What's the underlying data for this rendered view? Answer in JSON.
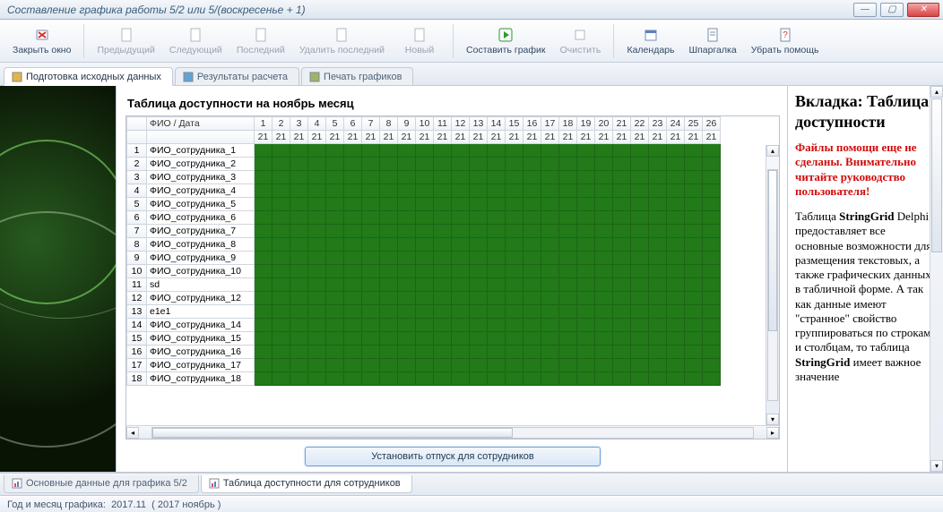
{
  "window": {
    "title": "Составление графика работы 5/2 или 5/(воскресенье + 1)"
  },
  "toolbar": {
    "close": "Закрыть окно",
    "prev": "Предыдущий",
    "next": "Следующий",
    "last": "Последний",
    "delete_last": "Удалить последний",
    "new": "Новый",
    "make": "Составить график",
    "clear": "Очистить",
    "calendar": "Календарь",
    "cheat": "Шпаргалка",
    "hide_help": "Убрать помощь"
  },
  "tabs_top": [
    {
      "label": "Подготовка исходных данных",
      "active": true
    },
    {
      "label": "Результаты расчета",
      "active": false
    },
    {
      "label": "Печать графиков",
      "active": false
    }
  ],
  "heading": "Таблица доступности на ноябрь месяц",
  "grid": {
    "fio_header": "ФИО / Дата",
    "days": [
      1,
      2,
      3,
      4,
      5,
      6,
      7,
      8,
      9,
      10,
      11,
      12,
      13,
      14,
      15,
      16,
      17,
      18,
      19,
      20,
      21,
      22,
      23,
      24,
      25,
      26
    ],
    "row2_value": "21",
    "rows": [
      {
        "n": 1,
        "fio": "ФИО_сотрудника_1"
      },
      {
        "n": 2,
        "fio": "ФИО_сотрудника_2"
      },
      {
        "n": 3,
        "fio": "ФИО_сотрудника_3"
      },
      {
        "n": 4,
        "fio": "ФИО_сотрудника_4"
      },
      {
        "n": 5,
        "fio": "ФИО_сотрудника_5"
      },
      {
        "n": 6,
        "fio": "ФИО_сотрудника_6"
      },
      {
        "n": 7,
        "fio": "ФИО_сотрудника_7"
      },
      {
        "n": 8,
        "fio": "ФИО_сотрудника_8"
      },
      {
        "n": 9,
        "fio": "ФИО_сотрудника_9"
      },
      {
        "n": 10,
        "fio": "ФИО_сотрудника_10"
      },
      {
        "n": 11,
        "fio": "sd"
      },
      {
        "n": 12,
        "fio": "ФИО_сотрудника_12"
      },
      {
        "n": 13,
        "fio": "e1e1"
      },
      {
        "n": 14,
        "fio": "ФИО_сотрудника_14"
      },
      {
        "n": 15,
        "fio": "ФИО_сотрудника_15"
      },
      {
        "n": 16,
        "fio": "ФИО_сотрудника_16"
      },
      {
        "n": 17,
        "fio": "ФИО_сотрудника_17"
      },
      {
        "n": 18,
        "fio": "ФИО_сотрудника_18"
      }
    ]
  },
  "action_button": "Установить отпуск для сотрудников",
  "help": {
    "title": "Вкладка: Таблица доступности",
    "warn": "Файлы помощи еще не сделаны. Внимательно читайте руководство пользователя!",
    "body_pre": "Таблица ",
    "body_b1": "StringGrid",
    "body_mid": " Delphi предоставляет все основные возможности для размещения текстовых, а также графических данных в табличной форме. А так как данные имеют \"странное\" свойство группироваться по строкам и столбцам, то таблица ",
    "body_b2": "StringGrid",
    "body_end": " имеет важное значение"
  },
  "tabs_bottom": [
    {
      "label": "Основные данные для графика 5/2",
      "active": false
    },
    {
      "label": "Таблица доступности для сотрудников",
      "active": true
    }
  ],
  "status": {
    "label": "Год и месяц графика:",
    "value": "2017.11",
    "paren": "( 2017  ноябрь )"
  }
}
